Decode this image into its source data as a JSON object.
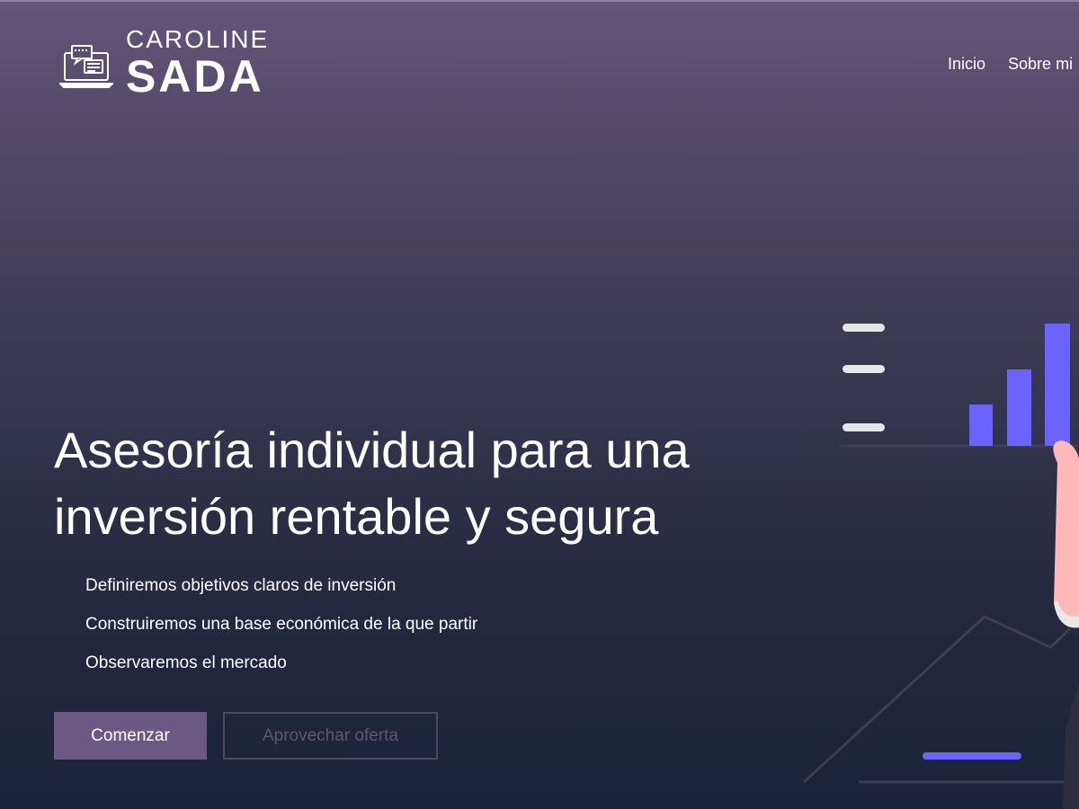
{
  "brand": {
    "line1": "CAROLINE",
    "line2": "SADA",
    "icon": "laptop-chat-icon"
  },
  "nav": {
    "items": [
      {
        "label": "Inicio"
      },
      {
        "label": "Sobre mi"
      }
    ]
  },
  "hero": {
    "title": "Asesoría individual para una inversión rentable y segura",
    "features": [
      "Definiremos objetivos claros de inversión",
      "Construiremos una base económica de la que partir",
      "Observaremos el mercado"
    ],
    "primary_button": "Comenzar",
    "secondary_button": "Aprovechar oferta"
  },
  "colors": {
    "gradient_top": "#64557a",
    "gradient_bottom": "#1b2239",
    "accent_bars": "#6c63ff",
    "button_primary": "#6a5982",
    "skin": "#ffb8b8"
  }
}
